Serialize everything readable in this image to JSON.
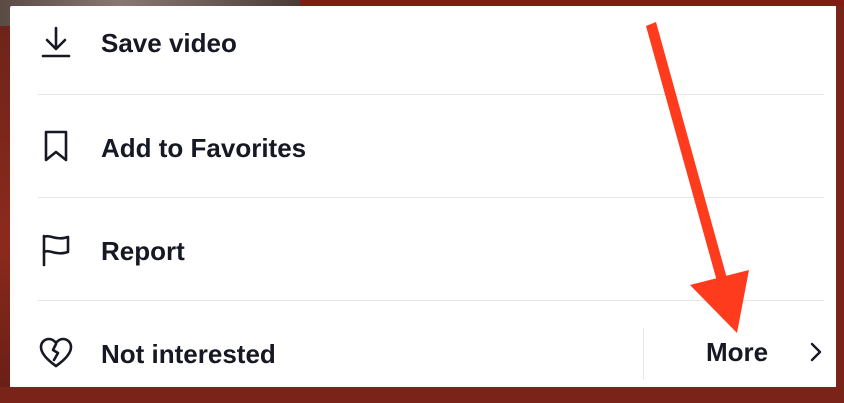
{
  "menu": {
    "items": [
      {
        "label": "Save video",
        "icon": "download-icon"
      },
      {
        "label": "Add to Favorites",
        "icon": "bookmark-icon"
      },
      {
        "label": "Report",
        "icon": "flag-icon"
      },
      {
        "label": "Not interested",
        "icon": "broken-heart-icon"
      }
    ],
    "more_label": "More",
    "more_icon": "chevron-right-icon"
  },
  "annotation": {
    "arrow_color": "#ff3b1d",
    "points_to": "more-button"
  },
  "colors": {
    "text": "#161823",
    "divider": "#e6e6e8",
    "sheet": "#ffffff",
    "backdrop": "#7a2318"
  }
}
